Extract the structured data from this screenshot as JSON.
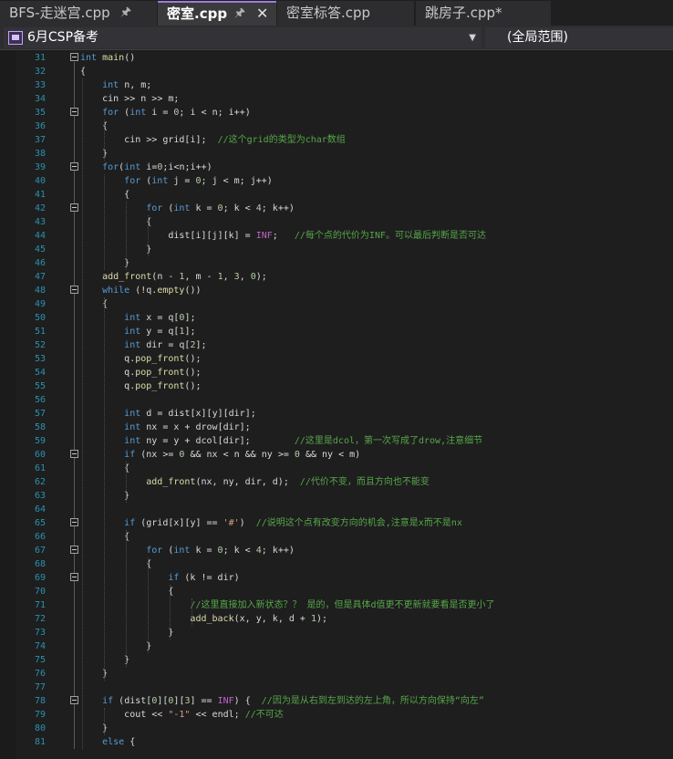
{
  "tabs": [
    {
      "label": "BFS-走迷宫.cpp",
      "pinned": true
    },
    {
      "label": "密室.cpp",
      "active": true,
      "pinned": true
    },
    {
      "label": "密室标答.cpp"
    },
    {
      "label": "跳房子.cpp*"
    }
  ],
  "navbar": {
    "project": "6月CSP备考",
    "scope": "(全局范围)"
  },
  "editor": {
    "lines": [
      {
        "n": "31",
        "code": "int main()"
      },
      {
        "n": "32",
        "code": "{"
      },
      {
        "n": "33",
        "code": "    int n, m;"
      },
      {
        "n": "34",
        "code": "    cin >> n >> m;"
      },
      {
        "n": "35",
        "code": "    for (int i = 0; i < n; i++)"
      },
      {
        "n": "36",
        "code": "    {"
      },
      {
        "n": "37",
        "code": "        cin >> grid[i];  //这个grid的类型为char数组"
      },
      {
        "n": "38",
        "code": "    }"
      },
      {
        "n": "39",
        "code": "    for(int i=0;i<n;i++)"
      },
      {
        "n": "40",
        "code": "        for (int j = 0; j < m; j++)"
      },
      {
        "n": "41",
        "code": "        {"
      },
      {
        "n": "42",
        "code": "            for (int k = 0; k < 4; k++)"
      },
      {
        "n": "43",
        "code": "            {"
      },
      {
        "n": "44",
        "code": "                dist[i][j][k] = INF;   //每个点的代价为INF。可以最后判断是否可达"
      },
      {
        "n": "45",
        "code": "            }"
      },
      {
        "n": "46",
        "code": "        }"
      },
      {
        "n": "47",
        "code": "    add_front(n - 1, m - 1, 3, 0);"
      },
      {
        "n": "48",
        "code": "    while (!q.empty())"
      },
      {
        "n": "49",
        "code": "    {"
      },
      {
        "n": "50",
        "code": "        int x = q[0];"
      },
      {
        "n": "51",
        "code": "        int y = q[1];"
      },
      {
        "n": "52",
        "code": "        int dir = q[2];"
      },
      {
        "n": "53",
        "code": "        q.pop_front();"
      },
      {
        "n": "54",
        "code": "        q.pop_front();"
      },
      {
        "n": "55",
        "code": "        q.pop_front();"
      },
      {
        "n": "56",
        "code": ""
      },
      {
        "n": "57",
        "code": "        int d = dist[x][y][dir];"
      },
      {
        "n": "58",
        "code": "        int nx = x + drow[dir];"
      },
      {
        "n": "59",
        "code": "        int ny = y + dcol[dir];        //这里是dcol，第一次写成了drow,注意细节"
      },
      {
        "n": "60",
        "code": "        if (nx >= 0 && nx < n && ny >= 0 && ny < m)"
      },
      {
        "n": "61",
        "code": "        {"
      },
      {
        "n": "62",
        "code": "            add_front(nx, ny, dir, d);  //代价不变，而且方向也不能变"
      },
      {
        "n": "63",
        "code": "        }"
      },
      {
        "n": "64",
        "code": ""
      },
      {
        "n": "65",
        "code": "        if (grid[x][y] == '#')  //说明这个点有改变方向的机会,注意是x而不是nx"
      },
      {
        "n": "66",
        "code": "        {"
      },
      {
        "n": "67",
        "code": "            for (int k = 0; k < 4; k++)"
      },
      {
        "n": "68",
        "code": "            {"
      },
      {
        "n": "69",
        "code": "                if (k != dir)"
      },
      {
        "n": "70",
        "code": "                {"
      },
      {
        "n": "71",
        "code": "                    //这里直接加入新状态？？ 是的，但是具体d值更不更新就要看是否更小了"
      },
      {
        "n": "72",
        "code": "                    add_back(x, y, k, d + 1);"
      },
      {
        "n": "73",
        "code": "                }"
      },
      {
        "n": "74",
        "code": "            }"
      },
      {
        "n": "75",
        "code": "        }"
      },
      {
        "n": "76",
        "code": "    }"
      },
      {
        "n": "77",
        "code": ""
      },
      {
        "n": "78",
        "code": "    if (dist[0][0][3] == INF) {  //因为是从右到左到达的左上角，所以方向保持“向左”"
      },
      {
        "n": "79",
        "code": "        cout << \"-1\" << endl; //不可达"
      },
      {
        "n": "80",
        "code": "    }"
      },
      {
        "n": "81",
        "code": "    else {"
      }
    ]
  }
}
